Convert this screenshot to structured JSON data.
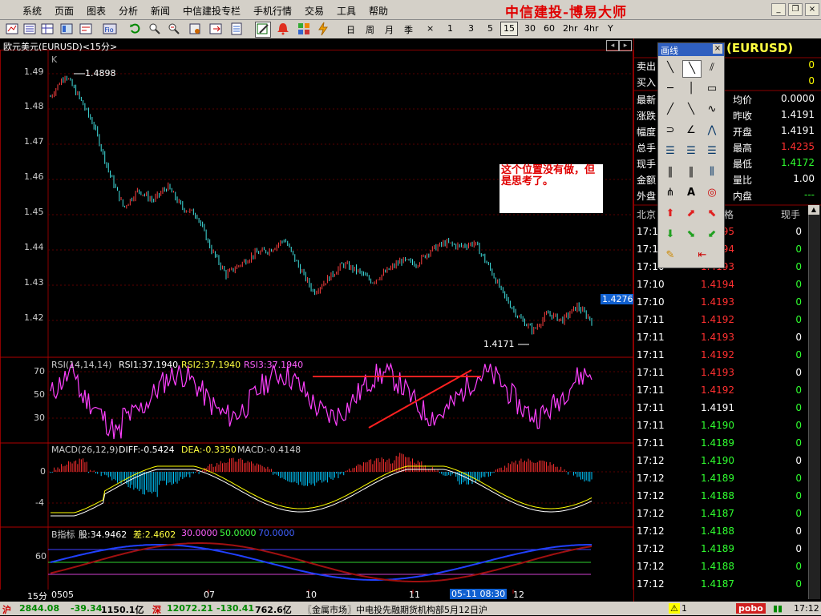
{
  "menu": {
    "items": [
      "系统",
      "页面",
      "图表",
      "分析",
      "新闻",
      "中信建投专栏",
      "手机行情",
      "交易",
      "工具",
      "帮助"
    ],
    "brand": "中信建投-博易大师"
  },
  "toolbar": {
    "periods": [
      "日",
      "周",
      "月",
      "季",
      "×",
      "1",
      "3",
      "5",
      "15",
      "30",
      "60",
      "2hr",
      "4hr",
      "Y"
    ],
    "selected_period": "15"
  },
  "chart": {
    "title": "欧元美元(EURUSD)<15分>",
    "k_label": "K",
    "price_ticks": [
      "1.49",
      "1.48",
      "1.47",
      "1.46",
      "1.45",
      "1.44",
      "1.43",
      "1.42"
    ],
    "high_marker": "1.4898",
    "low_marker": "1.4171",
    "current_price_tag": "1.4276",
    "annotation": "这个位置没有做，但是思考了。",
    "rsi": {
      "header": "RSI(14,14,14)",
      "rsi1": "RSI1:37.1940",
      "rsi2": "RSI2:37.1940",
      "rsi3": "RSI3:37.1940",
      "ticks": [
        "70",
        "50",
        "30"
      ]
    },
    "macd": {
      "header": "MACD(26,12,9)",
      "diff": "DIFF:-0.5424",
      "dea": "DEA:-0.3350",
      "macd": "MACD:-0.4148",
      "ticks": [
        "0",
        "-4"
      ]
    },
    "b_indicator": {
      "header": "B指标",
      "stock": "股:34.9462",
      "diff": "差:2.4602",
      "l30": "30.0000",
      "l50": "50.0000",
      "l70": "70.0000",
      "ticks": [
        "60"
      ]
    },
    "xaxis": {
      "period": "15分",
      "labels": [
        "0505",
        "07",
        "10",
        "11",
        "12"
      ],
      "cursor": "05-11 08:30"
    }
  },
  "chart_data": {
    "type": "candlestick",
    "x_labels": [
      "0505",
      "07",
      "10",
      "11",
      "12"
    ],
    "ylim": [
      1.415,
      1.495
    ],
    "price_series_approx": [
      1.4835,
      1.4898,
      1.483,
      1.475,
      1.462,
      1.452,
      1.457,
      1.454,
      1.458,
      1.452,
      1.45,
      1.44,
      1.433,
      1.436,
      1.439,
      1.44,
      1.443,
      1.435,
      1.428,
      1.432,
      1.436,
      1.434,
      1.431,
      1.434,
      1.437,
      1.436,
      1.44,
      1.442,
      1.441,
      1.442,
      1.435,
      1.427,
      1.421,
      1.4171,
      1.422,
      1.42,
      1.424,
      1.42
    ],
    "high": 1.4898,
    "low": 1.4171,
    "last": 1.4276
  },
  "right_panel": {
    "title": "(EURUSD)",
    "rows": [
      {
        "l": "卖出",
        "v": "0",
        "vc": "#ffff00"
      },
      {
        "l": "买入",
        "v": "0",
        "vc": "#ffff00"
      }
    ],
    "left_labels": [
      "最新",
      "涨跌",
      "幅度",
      "总手",
      "现手",
      "金额",
      "外盘"
    ],
    "stats": [
      {
        "l": "均价",
        "v": "0.0000",
        "vc": "#ffffff"
      },
      {
        "l": "昨收",
        "v": "1.4191",
        "vc": "#ffffff"
      },
      {
        "l": "开盘",
        "v": "1.4191",
        "vc": "#ffffff"
      },
      {
        "l": "最高",
        "v": "1.4235",
        "vc": "#ff3030"
      },
      {
        "l": "最低",
        "v": "1.4172",
        "vc": "#30ff30"
      },
      {
        "l": "量比",
        "v": "1.00",
        "vc": "#ffffff"
      },
      {
        "l": "内盘",
        "v": "---",
        "vc": "#30ff30"
      }
    ],
    "tick_header": {
      "time": "北京",
      "price": "格",
      "vol": "现手"
    },
    "ticks": [
      {
        "t": "17:10",
        "p": "95",
        "pc": "#ff3030",
        "v": "0",
        "vc": "#ffffff"
      },
      {
        "t": "17:10",
        "p": "94",
        "pc": "#ff3030",
        "v": "0",
        "vc": "#30ff30"
      },
      {
        "t": "17:10",
        "p": "1.4193",
        "pc": "#ff3030",
        "v": "0",
        "vc": "#30ff30"
      },
      {
        "t": "17:10",
        "p": "1.4194",
        "pc": "#ff3030",
        "v": "0",
        "vc": "#30ff30"
      },
      {
        "t": "17:10",
        "p": "1.4193",
        "pc": "#ff3030",
        "v": "0",
        "vc": "#30ff30"
      },
      {
        "t": "17:11",
        "p": "1.4192",
        "pc": "#ff3030",
        "v": "0",
        "vc": "#30ff30"
      },
      {
        "t": "17:11",
        "p": "1.4193",
        "pc": "#ff3030",
        "v": "0",
        "vc": "#ffffff"
      },
      {
        "t": "17:11",
        "p": "1.4192",
        "pc": "#ff3030",
        "v": "0",
        "vc": "#30ff30"
      },
      {
        "t": "17:11",
        "p": "1.4193",
        "pc": "#ff3030",
        "v": "0",
        "vc": "#ffffff"
      },
      {
        "t": "17:11",
        "p": "1.4192",
        "pc": "#ff3030",
        "v": "0",
        "vc": "#30ff30"
      },
      {
        "t": "17:11",
        "p": "1.4191",
        "pc": "#ffffff",
        "v": "0",
        "vc": "#30ff30"
      },
      {
        "t": "17:11",
        "p": "1.4190",
        "pc": "#30ff30",
        "v": "0",
        "vc": "#30ff30"
      },
      {
        "t": "17:11",
        "p": "1.4189",
        "pc": "#30ff30",
        "v": "0",
        "vc": "#30ff30"
      },
      {
        "t": "17:12",
        "p": "1.4190",
        "pc": "#30ff30",
        "v": "0",
        "vc": "#ffffff"
      },
      {
        "t": "17:12",
        "p": "1.4189",
        "pc": "#30ff30",
        "v": "0",
        "vc": "#30ff30"
      },
      {
        "t": "17:12",
        "p": "1.4188",
        "pc": "#30ff30",
        "v": "0",
        "vc": "#30ff30"
      },
      {
        "t": "17:12",
        "p": "1.4187",
        "pc": "#30ff30",
        "v": "0",
        "vc": "#30ff30"
      },
      {
        "t": "17:12",
        "p": "1.4188",
        "pc": "#30ff30",
        "v": "0",
        "vc": "#ffffff"
      },
      {
        "t": "17:12",
        "p": "1.4189",
        "pc": "#30ff30",
        "v": "0",
        "vc": "#ffffff"
      },
      {
        "t": "17:12",
        "p": "1.4188",
        "pc": "#30ff30",
        "v": "0",
        "vc": "#30ff30"
      },
      {
        "t": "17:12",
        "p": "1.4187",
        "pc": "#30ff30",
        "v": "0",
        "vc": "#30ff30"
      }
    ]
  },
  "draw_panel": {
    "title": "画线",
    "close": "×"
  },
  "statusbar": {
    "sh_label": "沪",
    "sh_value": "2844.08",
    "sh_change": "-39.34",
    "sh_amount": "1150.1亿",
    "sz_label": "深",
    "sz_value": "12072.21",
    "sz_change": "-130.41",
    "sz_amount": "762.6亿",
    "ticker": "〖金属市场〗中电投先融期货机构部5月12日沪",
    "alert": "1",
    "pobo": "pobo",
    "time": "17:12"
  },
  "colors": {
    "grid": "#8b0000",
    "candle_up": "#ff4040",
    "candle_down": "#40e0e0",
    "rsi": "#ff40ff",
    "macd_up": "#ff3030",
    "macd_down": "#00c8ff",
    "dif": "#ffffff",
    "dea": "#ffff00"
  }
}
